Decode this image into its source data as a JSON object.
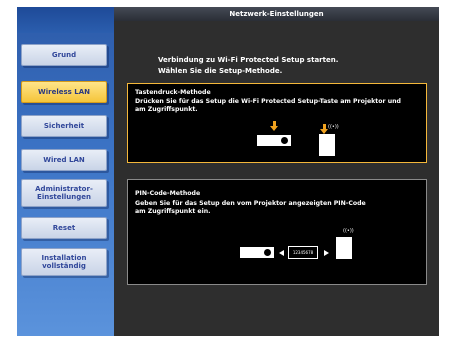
{
  "header": {
    "title": "Netzwerk-Einstellungen"
  },
  "sidebar": {
    "items": [
      {
        "label": "Grund"
      },
      {
        "label": "Wireless LAN"
      },
      {
        "label": "Sicherheit"
      },
      {
        "label": "Wired LAN"
      },
      {
        "label": "Administrator-\nEinstellungen"
      },
      {
        "label": "Reset"
      },
      {
        "label": "Installation\nvollständig"
      }
    ],
    "active_index": 1
  },
  "content": {
    "intro_line1": "Verbindung zu Wi-Fi Protected Setup starten.",
    "intro_line2": "Wählen Sie die Setup-Methode.",
    "options": [
      {
        "title": "Tastendruck-Methode",
        "desc_line1": "Drücken Sie für das Setup die Wi-Fi Protected Setup-Taste am Projektor und",
        "desc_line2": "am Zugriffspunkt.",
        "selected": true
      },
      {
        "title": "PIN-Code-Methode",
        "desc_line1": "Geben Sie für das Setup den vom Projektor angezeigten PIN-Code",
        "desc_line2": "am Zugriffspunkt ein.",
        "pin": "12345678",
        "selected": false
      }
    ],
    "wave_symbol": "((•))"
  },
  "colors": {
    "selected_border": "#f4b73a",
    "active_button": "#f5c53a",
    "arrow": "#f0a21f"
  }
}
